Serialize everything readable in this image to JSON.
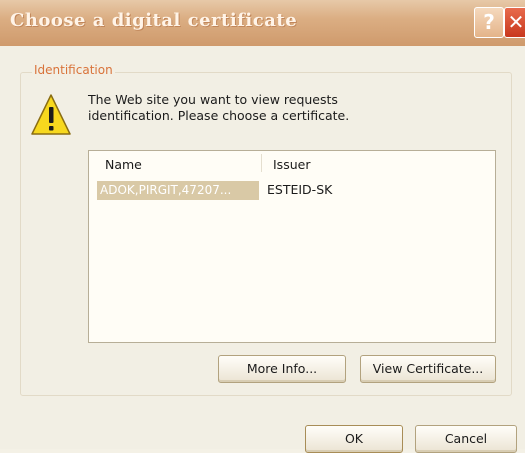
{
  "window": {
    "title": "Choose a digital certificate",
    "help_label": "?",
    "close_label": "✕"
  },
  "group": {
    "title": "Identification"
  },
  "message": {
    "line1": "The Web site you want to view requests",
    "line2": "identification. Please choose a certificate."
  },
  "certificate_list": {
    "columns": [
      "Name",
      "Issuer"
    ],
    "rows": [
      {
        "name": "ADOK,PIRGIT,47207...",
        "issuer": "ESTEID-SK",
        "selected": true
      }
    ]
  },
  "buttons": {
    "more_info": "More Info...",
    "view_certificate": "View Certificate...",
    "ok": "OK",
    "cancel": "Cancel"
  },
  "icons": {
    "warning": "warning-icon",
    "help": "help-icon",
    "close": "close-icon"
  },
  "colors": {
    "titlebar": "#d7a77b",
    "group_title": "#d9733a",
    "selection": "#d9c9a6",
    "warning_fill": "#f7d81e"
  }
}
